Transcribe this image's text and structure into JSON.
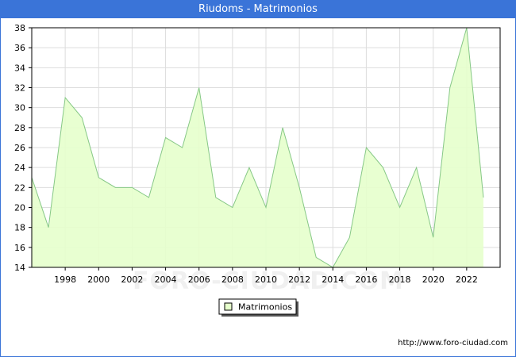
{
  "window": {
    "title": "Riudoms - Matrimonios"
  },
  "footer": {
    "url": "http://www.foro-ciudad.com"
  },
  "watermark": "FORO-CIUDAD.COM",
  "colors": {
    "title_bg": "#3a74d8",
    "line": "#86c886",
    "fill": "#e6ffcc",
    "grid": "#dddddd"
  },
  "chart_data": {
    "type": "area",
    "title": "Riudoms - Matrimonios",
    "xlabel": "",
    "ylabel": "",
    "x": [
      1996,
      1997,
      1998,
      1999,
      2000,
      2001,
      2002,
      2003,
      2004,
      2005,
      2006,
      2007,
      2008,
      2009,
      2010,
      2011,
      2012,
      2013,
      2014,
      2015,
      2016,
      2017,
      2018,
      2019,
      2020,
      2021,
      2022,
      2023
    ],
    "series": [
      {
        "name": "Matrimonios",
        "values": [
          23,
          18,
          31,
          29,
          23,
          22,
          22,
          21,
          27,
          26,
          32,
          21,
          20,
          24,
          20,
          28,
          22,
          15,
          14,
          17,
          26,
          24,
          20,
          24,
          17,
          32,
          38,
          21
        ]
      }
    ],
    "xlim": [
      1996,
      2024
    ],
    "ylim": [
      14,
      38
    ],
    "xticks": [
      1998,
      2000,
      2002,
      2004,
      2006,
      2008,
      2010,
      2012,
      2014,
      2016,
      2018,
      2020,
      2022
    ],
    "yticks": [
      14,
      16,
      18,
      20,
      22,
      24,
      26,
      28,
      30,
      32,
      34,
      36,
      38
    ],
    "grid": true,
    "legend": "bottom-center"
  }
}
